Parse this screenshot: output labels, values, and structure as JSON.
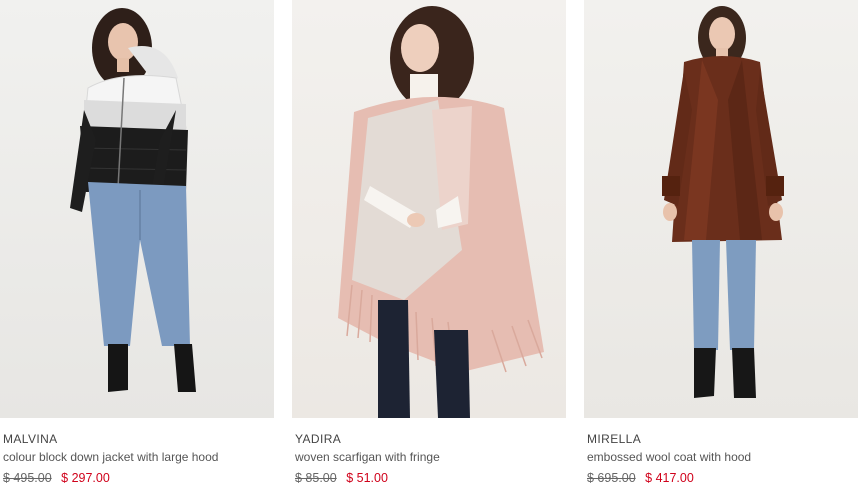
{
  "products": [
    {
      "name": "MALVINA",
      "description": "colour block down jacket with large hood",
      "original_price": "$ 495.00",
      "sale_price": "$ 297.00"
    },
    {
      "name": "YADIRA",
      "description": "woven scarfigan with fringe",
      "original_price": "$ 85.00",
      "sale_price": "$ 51.00"
    },
    {
      "name": "MIRELLA",
      "description": "embossed wool coat with hood",
      "original_price": "$ 695.00",
      "sale_price": "$ 417.00"
    }
  ],
  "colors": {
    "sale_price": "#d0021b",
    "original_price": "#666666",
    "text": "#444444"
  }
}
